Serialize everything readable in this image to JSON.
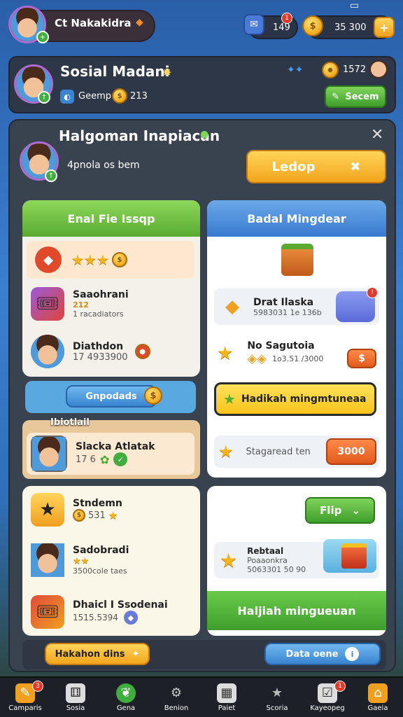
{
  "topbar": {
    "profile_label": "Ct Nakakidra",
    "inbox_count": "149",
    "inbox_badge": "1",
    "coins": "35 300"
  },
  "header": {
    "title": "Sosial Madani",
    "subtitle": "Geemp",
    "subvalue": "213",
    "gems": "1572",
    "action_label": "Secem"
  },
  "main": {
    "title": "Halgoman Inapiacan",
    "subtitle": "4pnola os bem",
    "primary_button": "Ledop",
    "left_card": {
      "header": "Enal Fie Issqp",
      "items": [
        {
          "title": "Saaohrani",
          "line1": "212",
          "line2": "1 racadiators"
        },
        {
          "title": "Diathdon",
          "line1": "17 4933900"
        }
      ],
      "button": "Gnpodads"
    },
    "right_card": {
      "header": "Badal Mingdear",
      "items": [
        {
          "title": "Drat Ilaska",
          "line1": "5983031 1e 136b"
        },
        {
          "title": "No Sagutoia",
          "line1": "1o3.51 /3000"
        }
      ],
      "highlight_button": "Hadikah mingmtuneaa",
      "cost_label": "Stagaread ten",
      "cost_value": "3000"
    },
    "section_label": "Ibiotlail",
    "mid_left": {
      "title": "Slacka Atlatak",
      "line1": "17 6"
    },
    "lower_left": {
      "items": [
        {
          "title": "Stndemn",
          "line1": "531"
        },
        {
          "title": "Sadobradi",
          "line1": "3500cole taes"
        },
        {
          "title": "Dhaicl I Ssodenai",
          "line1": "1515.5394"
        }
      ]
    },
    "lower_right": {
      "flip_button": "Flip",
      "item_title": "Rebtaal",
      "item_line1": "Poaaonkra",
      "item_line2": "5063301 50 90",
      "bottom_button": "Haljiah mingueuan"
    },
    "footer_left": "Hakahon dins",
    "footer_right": "Data oene"
  },
  "nav": [
    {
      "label": "Camparis",
      "icon": "pencil-icon",
      "badge": "3"
    },
    {
      "label": "Sosia",
      "icon": "dice-icon"
    },
    {
      "label": "Gena",
      "icon": "leaf-icon"
    },
    {
      "label": "Benion",
      "icon": "gear-icon"
    },
    {
      "label": "Paiet",
      "icon": "grid-icon"
    },
    {
      "label": "Scoria",
      "icon": "star-icon"
    },
    {
      "label": "Kayeopeg",
      "icon": "check-icon",
      "badge": "1"
    },
    {
      "label": "Gaeia",
      "icon": "shop-icon"
    }
  ],
  "colors": {
    "accent_yellow": "#f3a51c",
    "accent_green": "#3f9e2c",
    "panel": "#39424f"
  }
}
